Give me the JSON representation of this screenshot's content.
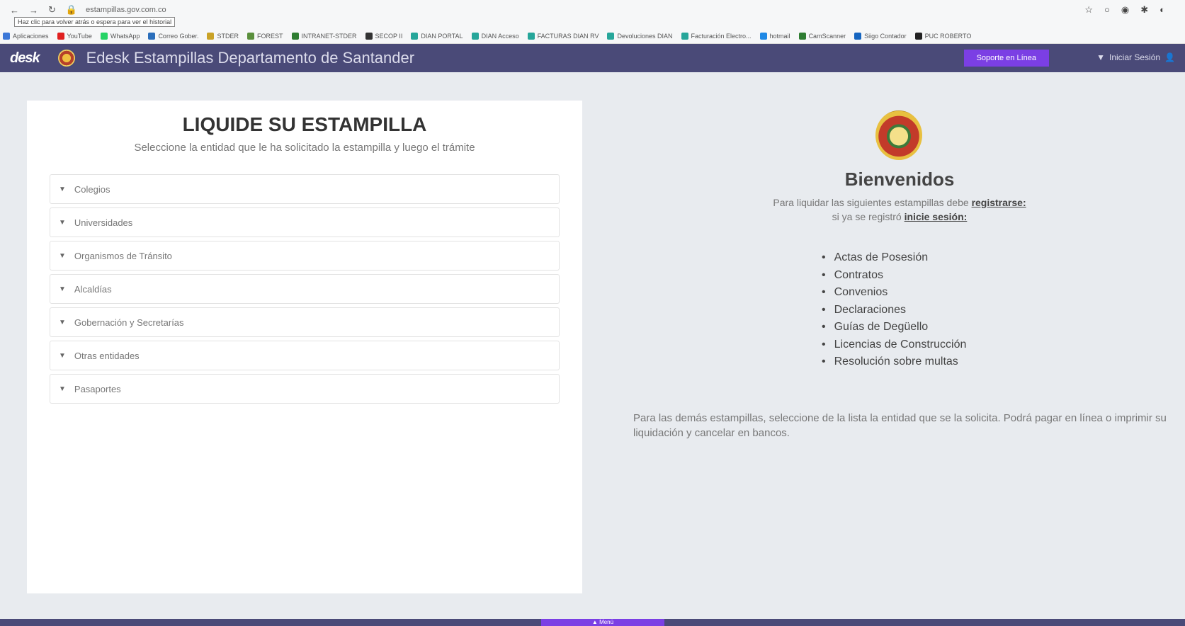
{
  "browser": {
    "url": "estampillas.gov.com.co",
    "tooltip": "Haz clic para volver atrás o espera para ver el historial",
    "bookmarks": [
      {
        "label": "Aplicaciones",
        "color": "#3c78d8"
      },
      {
        "label": "YouTube",
        "color": "#e02020"
      },
      {
        "label": "WhatsApp",
        "color": "#25d366"
      },
      {
        "label": "Correo Gober.",
        "color": "#2a6ebb"
      },
      {
        "label": "STDER",
        "color": "#c9a227"
      },
      {
        "label": "FOREST",
        "color": "#5a8f3c"
      },
      {
        "label": "INTRANET-STDER",
        "color": "#2e7d32"
      },
      {
        "label": "SECOP II",
        "color": "#333333"
      },
      {
        "label": "DIAN PORTAL",
        "color": "#26a69a"
      },
      {
        "label": "DIAN Acceso",
        "color": "#26a69a"
      },
      {
        "label": "FACTURAS DIAN RV",
        "color": "#26a69a"
      },
      {
        "label": "Devoluciones DIAN",
        "color": "#26a69a"
      },
      {
        "label": "Facturación Electro...",
        "color": "#26a69a"
      },
      {
        "label": "hotmail",
        "color": "#1e88e5"
      },
      {
        "label": "CamScanner",
        "color": "#2e7d32"
      },
      {
        "label": "Siigo Contador",
        "color": "#1565c0"
      },
      {
        "label": "PUC ROBERTO",
        "color": "#222222"
      }
    ]
  },
  "header": {
    "logo": "desk",
    "title": "Edesk Estampillas Departamento de Santander",
    "support_label": "Soporte en Línea",
    "login_label": "Iniciar Sesión"
  },
  "left": {
    "title": "LIQUIDE SU ESTAMPILLA",
    "subtitle": "Seleccione la entidad que le ha solicitado la estampilla y luego el trámite",
    "items": [
      "Colegios",
      "Universidades",
      "Organismos de Tránsito",
      "Alcaldías",
      "Gobernación y Secretarías",
      "Otras entidades",
      "Pasaportes"
    ]
  },
  "right": {
    "welcome": "Bienvenidos",
    "intro_prefix": "Para liquidar las siguientes estampillas debe ",
    "register_link": "registrarse:",
    "intro2_prefix": "si ya se registró ",
    "login_link": "inicie sesión:",
    "stamps": [
      "Actas de Posesión",
      "Contratos",
      "Convenios",
      "Declaraciones",
      "Guías de Degüello",
      "Licencias de Construcción",
      "Resolución sobre multas"
    ],
    "note": "Para las demás estampillas, seleccione de la lista la entidad que se la solicita. Podrá pagar en línea o imprimir su liquidación y cancelar en bancos."
  },
  "footer": {
    "menu_label": "Menú"
  },
  "colors": {
    "header_bg": "#4a4a78",
    "accent": "#7b3fe4",
    "page_bg": "#e8ebef"
  }
}
